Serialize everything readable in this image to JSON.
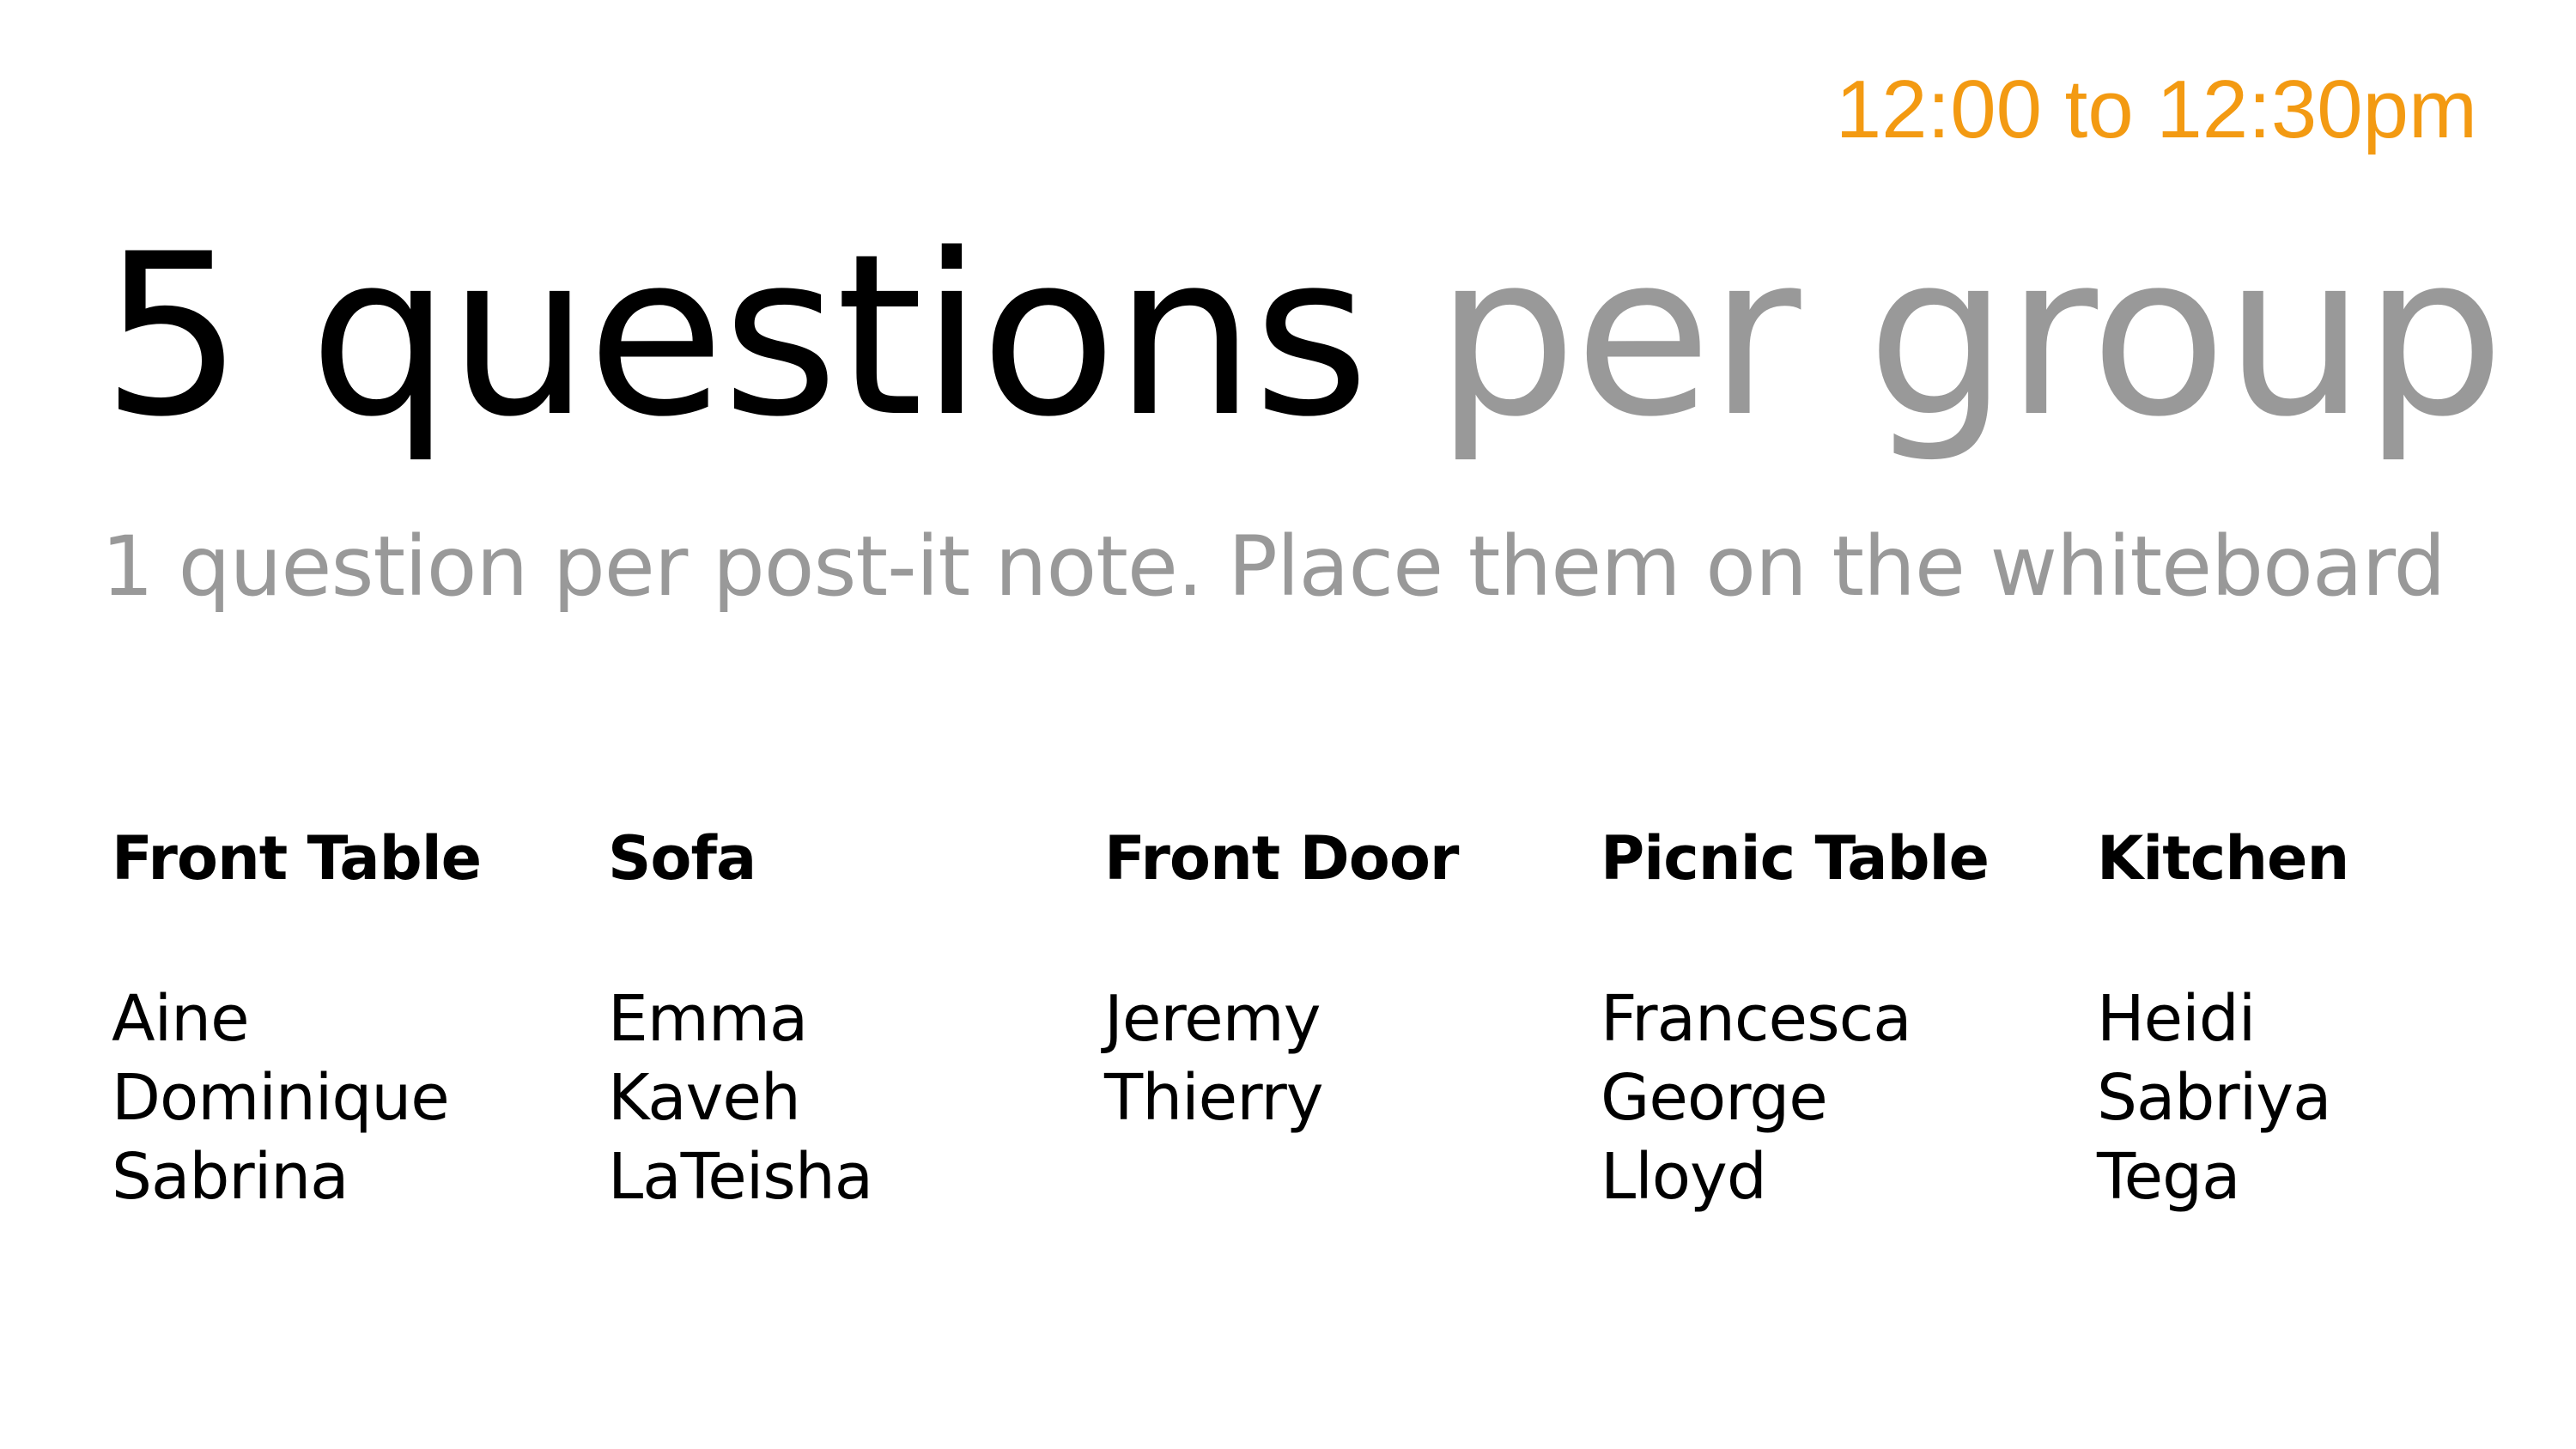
{
  "time_range": "12:00 to 12:30pm",
  "title": {
    "strong": "5 questions",
    "soft": "per group"
  },
  "subtitle": "1 question per post-it note. Place them on the whiteboard",
  "groups": [
    {
      "name": "Front Table",
      "members": [
        "Aine",
        "Dominique",
        "Sabrina"
      ]
    },
    {
      "name": "Sofa",
      "members": [
        "Emma",
        "Kaveh",
        "LaTeisha"
      ]
    },
    {
      "name": "Front Door",
      "members": [
        "Jeremy",
        "Thierry"
      ]
    },
    {
      "name": "Picnic Table",
      "members": [
        "Francesca",
        "George",
        "Lloyd"
      ]
    },
    {
      "name": "Kitchen",
      "members": [
        "Heidi",
        "Sabriya",
        "Tega"
      ]
    }
  ],
  "colors": {
    "accent": "#f39a12",
    "muted": "#999999",
    "text": "#000000"
  }
}
